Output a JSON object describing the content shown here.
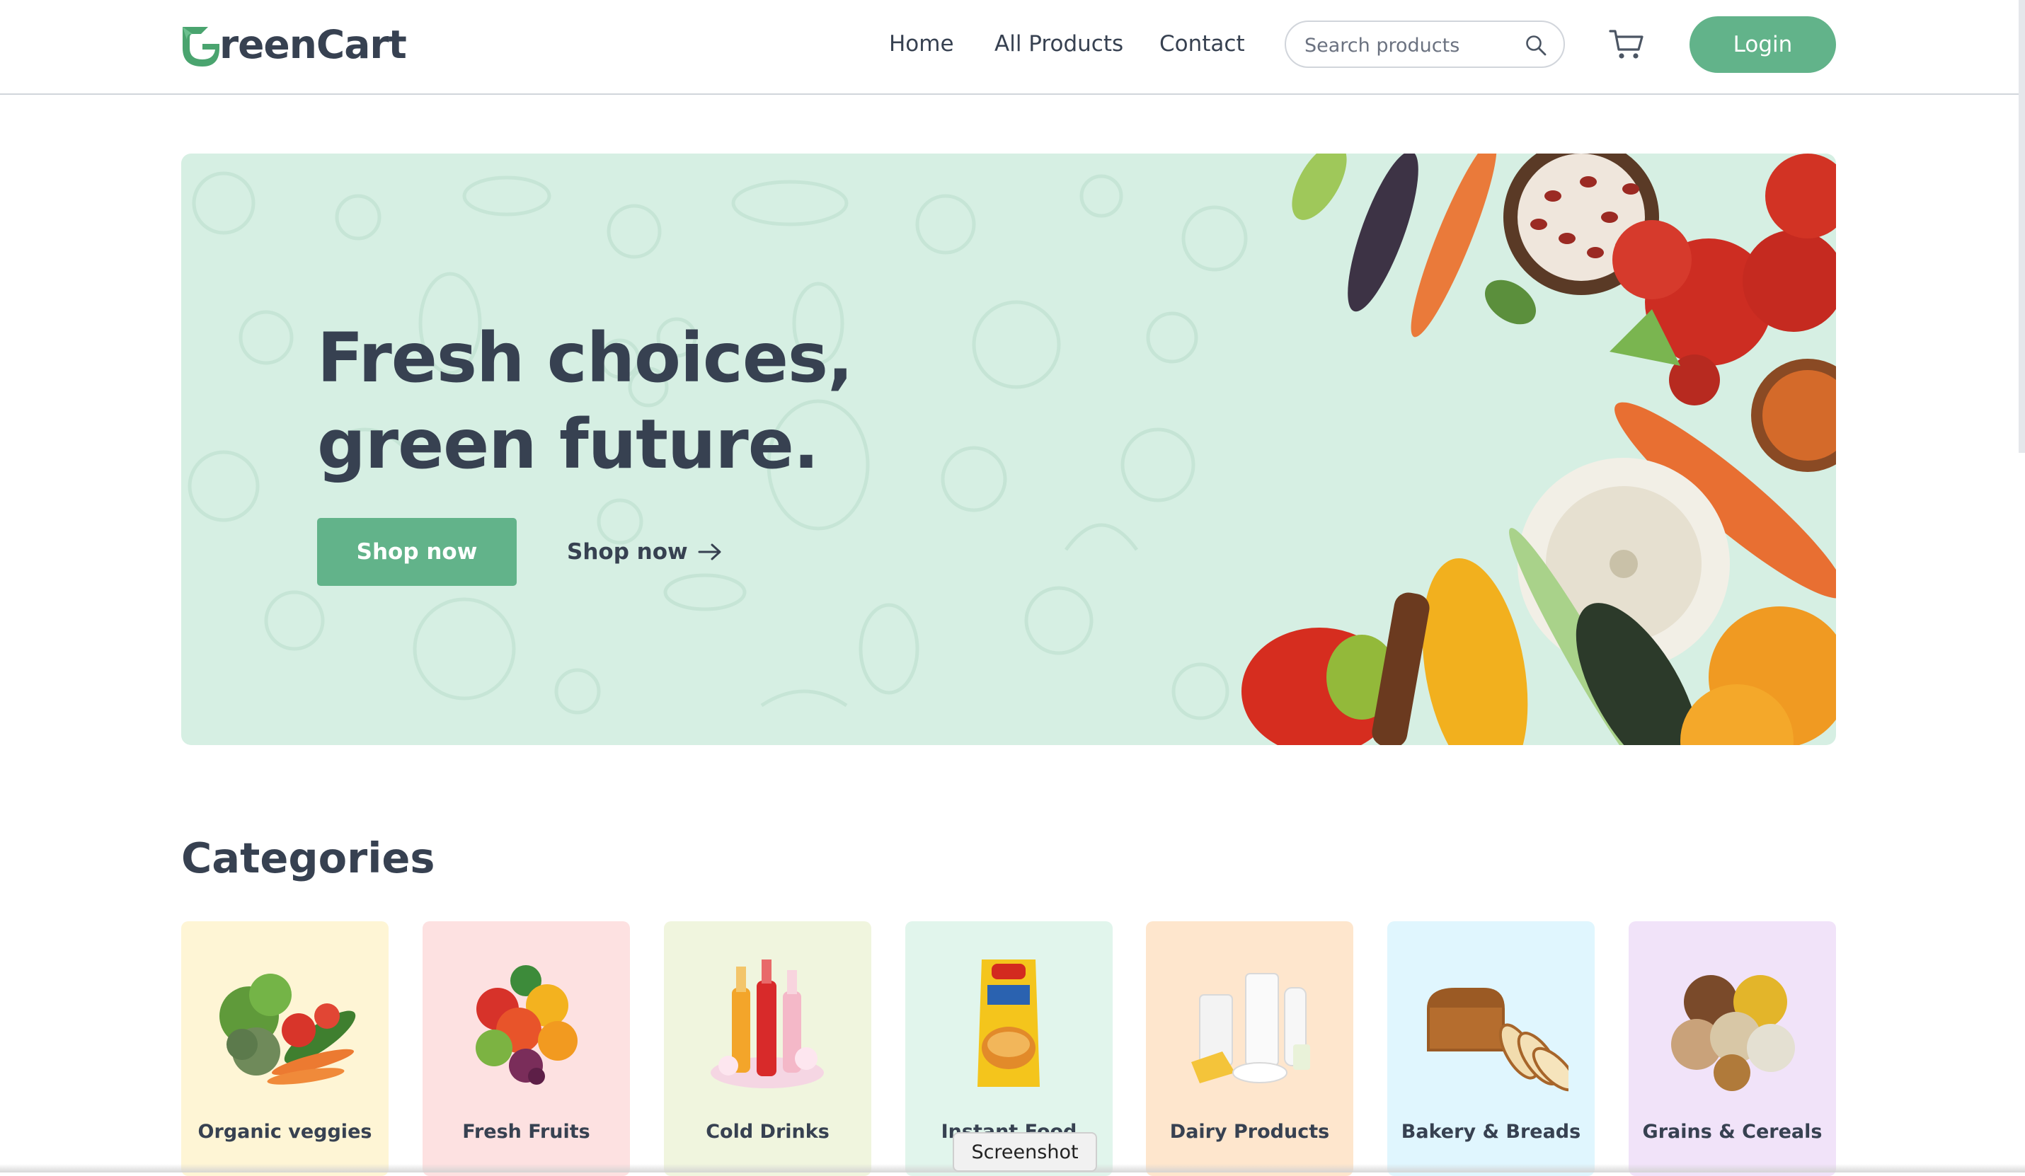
{
  "brand": {
    "name": "reenCart",
    "accent": "#62b38a",
    "text_color": "#374151"
  },
  "nav": {
    "links": [
      {
        "label": "Home"
      },
      {
        "label": "All Products"
      },
      {
        "label": "Contact"
      }
    ],
    "search": {
      "placeholder": "Search products",
      "value": "",
      "icon": "search-icon"
    },
    "cart_icon": "cart-icon",
    "login_label": "Login"
  },
  "hero": {
    "title_line1": "Fresh choices,",
    "title_line2": "green future.",
    "primary_button": "Shop now",
    "secondary_link": "Shop now",
    "background": "#d6efe3"
  },
  "categories": {
    "title": "Categories",
    "items": [
      {
        "label": "Organic veggies",
        "bg": "#fef5d5"
      },
      {
        "label": "Fresh Fruits",
        "bg": "#fde1e1"
      },
      {
        "label": "Cold Drinks",
        "bg": "#f0f5de"
      },
      {
        "label": "Instant Food",
        "bg": "#e1f5ec"
      },
      {
        "label": "Dairy Products",
        "bg": "#fee6cd"
      },
      {
        "label": "Bakery & Breads",
        "bg": "#e0f6fe"
      },
      {
        "label": "Grains & Cereals",
        "bg": "#f1e3f9"
      }
    ]
  },
  "tooltip": "Screenshot"
}
